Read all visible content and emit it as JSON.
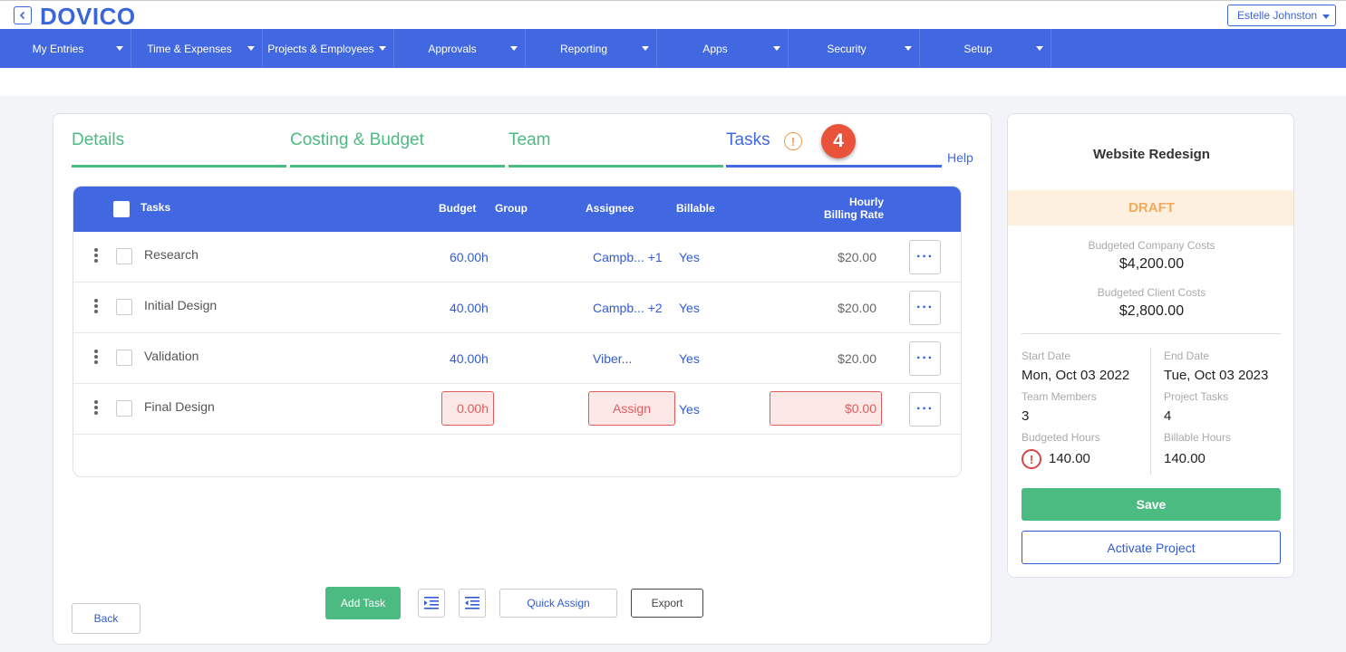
{
  "header": {
    "logo": "DOVICO",
    "user": "Estelle Johnston"
  },
  "nav": [
    {
      "label": "My Entries"
    },
    {
      "label": "Time & Expenses"
    },
    {
      "label": "Projects & Employees"
    },
    {
      "label": "Approvals"
    },
    {
      "label": "Reporting"
    },
    {
      "label": "Apps"
    },
    {
      "label": "Security"
    },
    {
      "label": "Setup"
    }
  ],
  "tabs": {
    "details": "Details",
    "costing": "Costing & Budget",
    "team": "Team",
    "tasks": "Tasks",
    "warning_glyph": "!",
    "step_number": "4",
    "help": "Help"
  },
  "table": {
    "headers": {
      "tasks": "Tasks",
      "budget": "Budget",
      "group": "Group",
      "assignee": "Assignee",
      "billable": "Billable",
      "rate_line1": "Hourly",
      "rate_line2": "Billing Rate"
    },
    "more_glyph": "···",
    "rows": [
      {
        "name": "Research",
        "budget": "60.00h",
        "assignee": "Campb... +1",
        "billable": "Yes",
        "rate": "$20.00"
      },
      {
        "name": "Initial Design",
        "budget": "40.00h",
        "assignee": "Campb... +2",
        "billable": "Yes",
        "rate": "$20.00"
      },
      {
        "name": "Validation",
        "budget": "40.00h",
        "assignee": "Viber...",
        "billable": "Yes",
        "rate": "$20.00"
      },
      {
        "name": "Final Design",
        "budget": "0.00h",
        "assignee": "Assign",
        "billable": "Yes",
        "rate": "$0.00"
      }
    ]
  },
  "actions": {
    "back": "Back",
    "add_task": "Add Task",
    "quick_assign": "Quick Assign",
    "export": "Export"
  },
  "summary": {
    "project_name": "Website Redesign",
    "status": "DRAFT",
    "company_costs_label": "Budgeted Company Costs",
    "company_costs": "$4,200.00",
    "client_costs_label": "Budgeted Client Costs",
    "client_costs": "$2,800.00",
    "start_date_label": "Start Date",
    "start_date": "Mon, Oct 03 2022",
    "end_date_label": "End Date",
    "end_date": "Tue, Oct 03 2023",
    "team_members_label": "Team Members",
    "team_members": "3",
    "project_tasks_label": "Project Tasks",
    "project_tasks": "4",
    "budgeted_hours_label": "Budgeted Hours",
    "budgeted_hours": "140.00",
    "billable_hours_label": "Billable Hours",
    "billable_hours": "140.00",
    "error_glyph": "!",
    "save": "Save",
    "activate": "Activate Project"
  },
  "colors": {
    "primary": "#4168e0",
    "green": "#4cbb82",
    "error": "#e15b5b",
    "draft": "#f4a95c"
  }
}
